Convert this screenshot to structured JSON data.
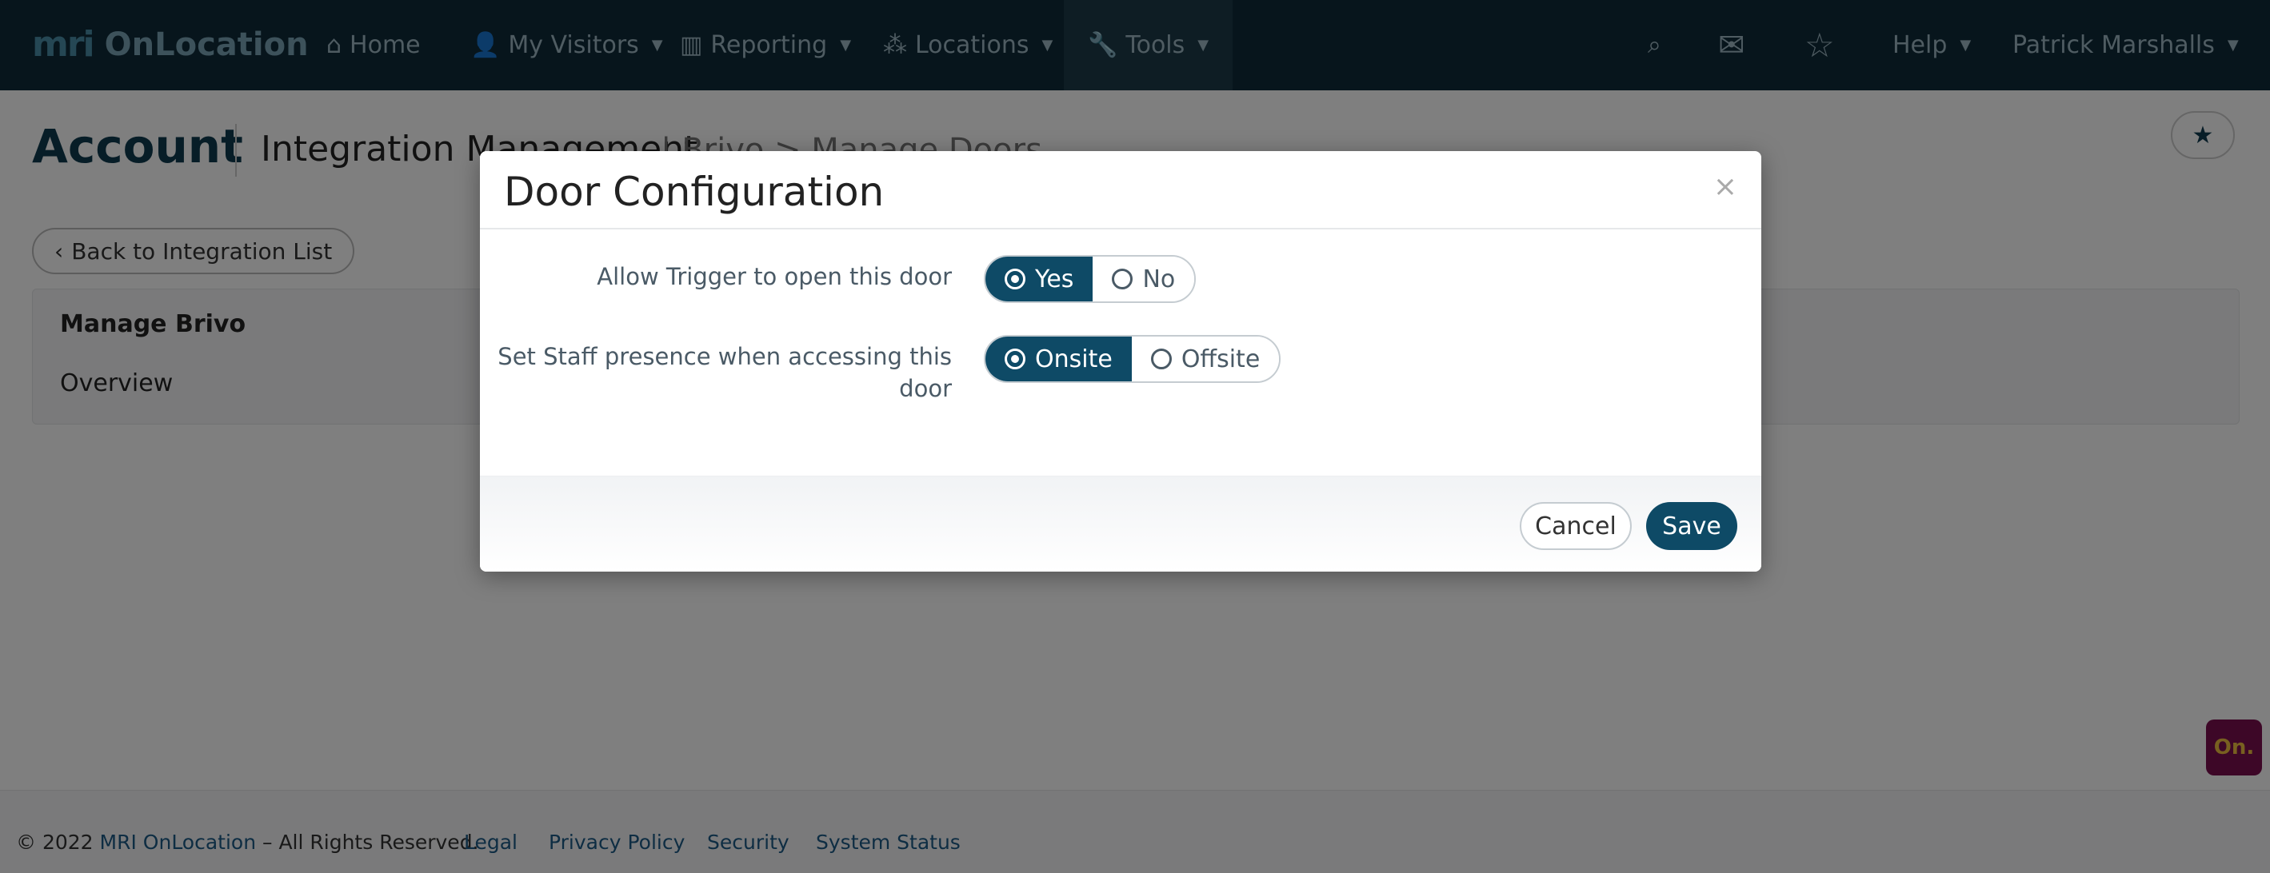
{
  "brand": {
    "mark": "mri",
    "name": "OnLocation"
  },
  "nav": {
    "home": "Home",
    "visitors": "My Visitors",
    "reporting": "Reporting",
    "locations": "Locations",
    "tools": "Tools",
    "help": "Help",
    "user": "Patrick Marshalls"
  },
  "page": {
    "title": "Account",
    "subtitle": "Integration Management",
    "crumb": "| Brivo > Manage Doors",
    "back_label": "Back to Integration List",
    "card_title": "Manage Brivo",
    "card_item": "Overview"
  },
  "modal": {
    "title": "Door Configuration",
    "close": "×",
    "trigger_label": "Allow Trigger to open this door",
    "trigger_options": {
      "yes": "Yes",
      "no": "No"
    },
    "trigger_selected": "Yes",
    "presence_label_1": "Set Staff presence when accessing this",
    "presence_label_2": "door",
    "presence_options": {
      "onsite": "Onsite",
      "offsite": "Offsite"
    },
    "presence_selected": "Onsite",
    "cancel": "Cancel",
    "save": "Save"
  },
  "footer": {
    "copyright": "© 2022 ",
    "company": "MRI OnLocation",
    "rights": " – All Rights Reserved.",
    "legal": "Legal",
    "privacy": "Privacy Policy",
    "security": "Security",
    "status": "System Status",
    "badge": "On."
  },
  "colors": {
    "navbar": "#0e2a38",
    "accent": "#0e4a66",
    "link": "#1c5a86"
  }
}
